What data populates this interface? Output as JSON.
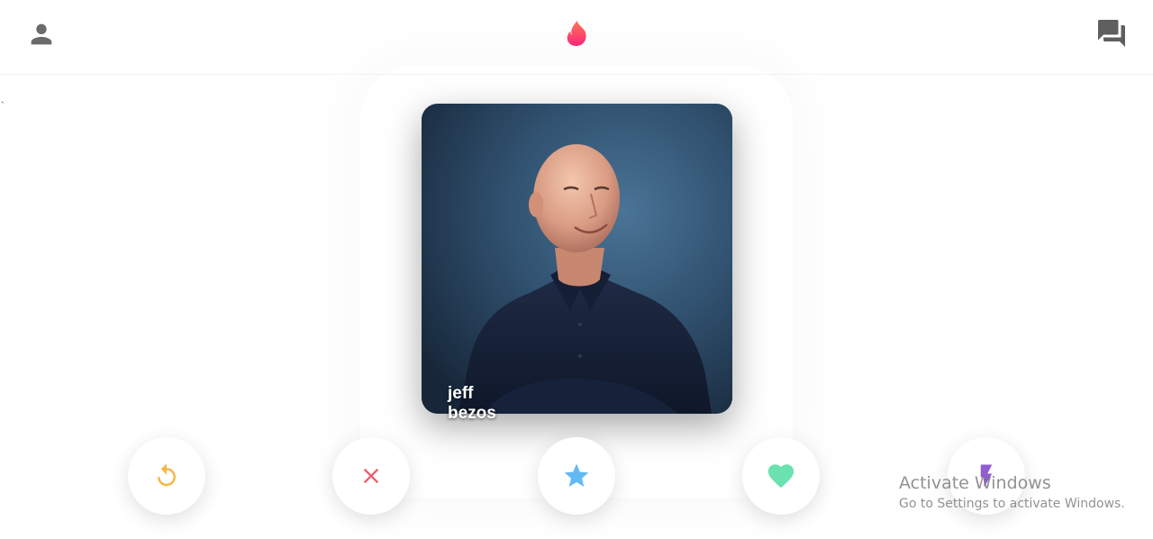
{
  "header": {
    "profile_icon": "person-icon",
    "logo_icon": "flame-icon",
    "chat_icon": "forum-icon",
    "logo_color": "#fd5068"
  },
  "stray_mark": "`",
  "card": {
    "name": "jeff bezos"
  },
  "actions": [
    {
      "name": "repeat",
      "icon": "replay-icon",
      "color": "#f5b748"
    },
    {
      "name": "close",
      "icon": "close-icon",
      "color": "#ec5e6f"
    },
    {
      "name": "star",
      "icon": "star-icon",
      "color": "#62baf3"
    },
    {
      "name": "like",
      "icon": "heart-icon",
      "color": "#6be2b0"
    },
    {
      "name": "boost",
      "icon": "flash-icon",
      "color": "#915dd1"
    }
  ],
  "watermark": {
    "title": "Activate Windows",
    "subtitle": "Go to Settings to activate Windows."
  }
}
